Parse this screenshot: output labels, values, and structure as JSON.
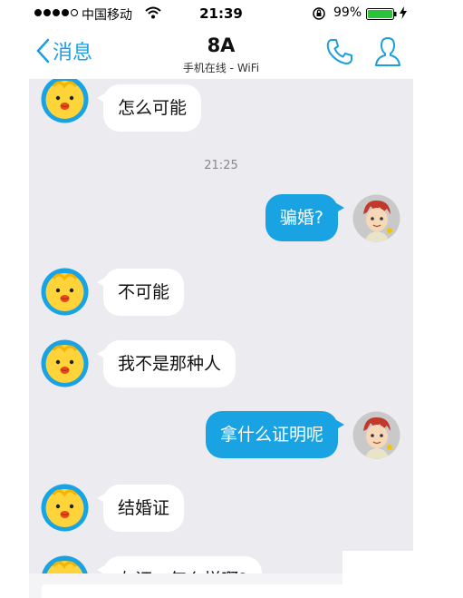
{
  "status_bar": {
    "carrier": "中国移动",
    "time": "21:39",
    "battery": "99%"
  },
  "nav": {
    "back_label": "消息",
    "title": "8A",
    "subtitle": "手机在线 - WiFi"
  },
  "chat": {
    "time_divider": "21:25",
    "messages": [
      {
        "side": "left",
        "text": "怎么可能"
      },
      {
        "side": "right",
        "text": "骗婚?"
      },
      {
        "side": "left",
        "text": "不可能"
      },
      {
        "side": "left",
        "text": "我不是那种人"
      },
      {
        "side": "right",
        "text": "拿什么证明呢"
      },
      {
        "side": "left",
        "text": "结婚证"
      },
      {
        "side": "left",
        "text": "左证一怎么样啊?"
      }
    ]
  },
  "colors": {
    "accent": "#1a9fe0",
    "outgoing_bubble": "#1aa3e3",
    "chat_background": "#ebebf0"
  },
  "icons": {
    "back": "chevron-left-icon",
    "call": "phone-icon",
    "profile": "person-icon"
  }
}
